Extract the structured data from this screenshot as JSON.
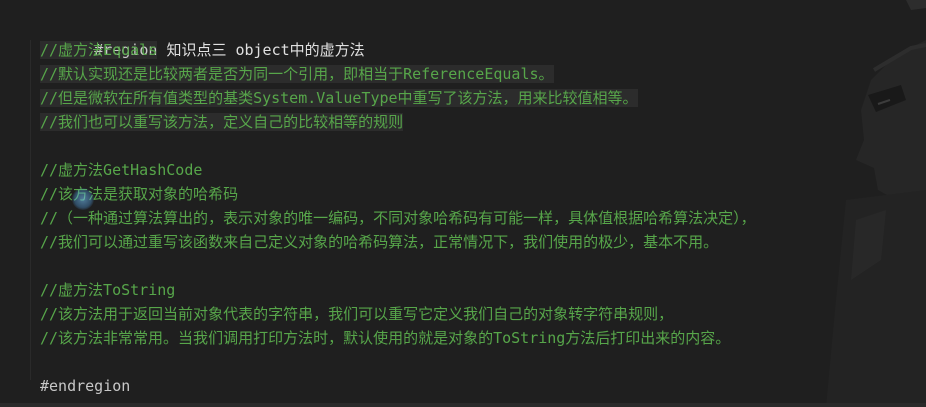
{
  "region_start": {
    "keyword": "#region",
    "title": "知识点三 object中的虚方法"
  },
  "sections": [
    {
      "lines": [
        "//虚方法Equals",
        "//默认实现还是比较两者是否为同一个引用，即相当于ReferenceEquals。",
        "//但是微软在所有值类型的基类System.ValueType中重写了该方法，用来比较值相等。",
        "//我们也可以重写该方法，定义自己的比较相等的规则"
      ]
    },
    {
      "lines": [
        "//虚方法GetHashCode",
        "//该方法是获取对象的哈希码",
        "//（一种通过算法算出的，表示对象的唯一编码，不同对象哈希码有可能一样，具体值根据哈希算法决定），",
        "//我们可以通过重写该函数来自己定义对象的哈希码算法，正常情况下，我们使用的极少，基本不用。"
      ]
    },
    {
      "lines": [
        "//虚方法ToString",
        "//该方法用于返回当前对象代表的字符串，我们可以重写它定义我们自己的对象转字符串规则，",
        "//该方法非常常用。当我们调用打印方法时，默认使用的就是对象的ToString方法后打印出来的内容。"
      ]
    }
  ],
  "region_end": {
    "keyword": "#endregion"
  },
  "colors": {
    "background": "#1f1f1f",
    "comment": "#57a64a",
    "keyword": "#c8c8c8"
  }
}
